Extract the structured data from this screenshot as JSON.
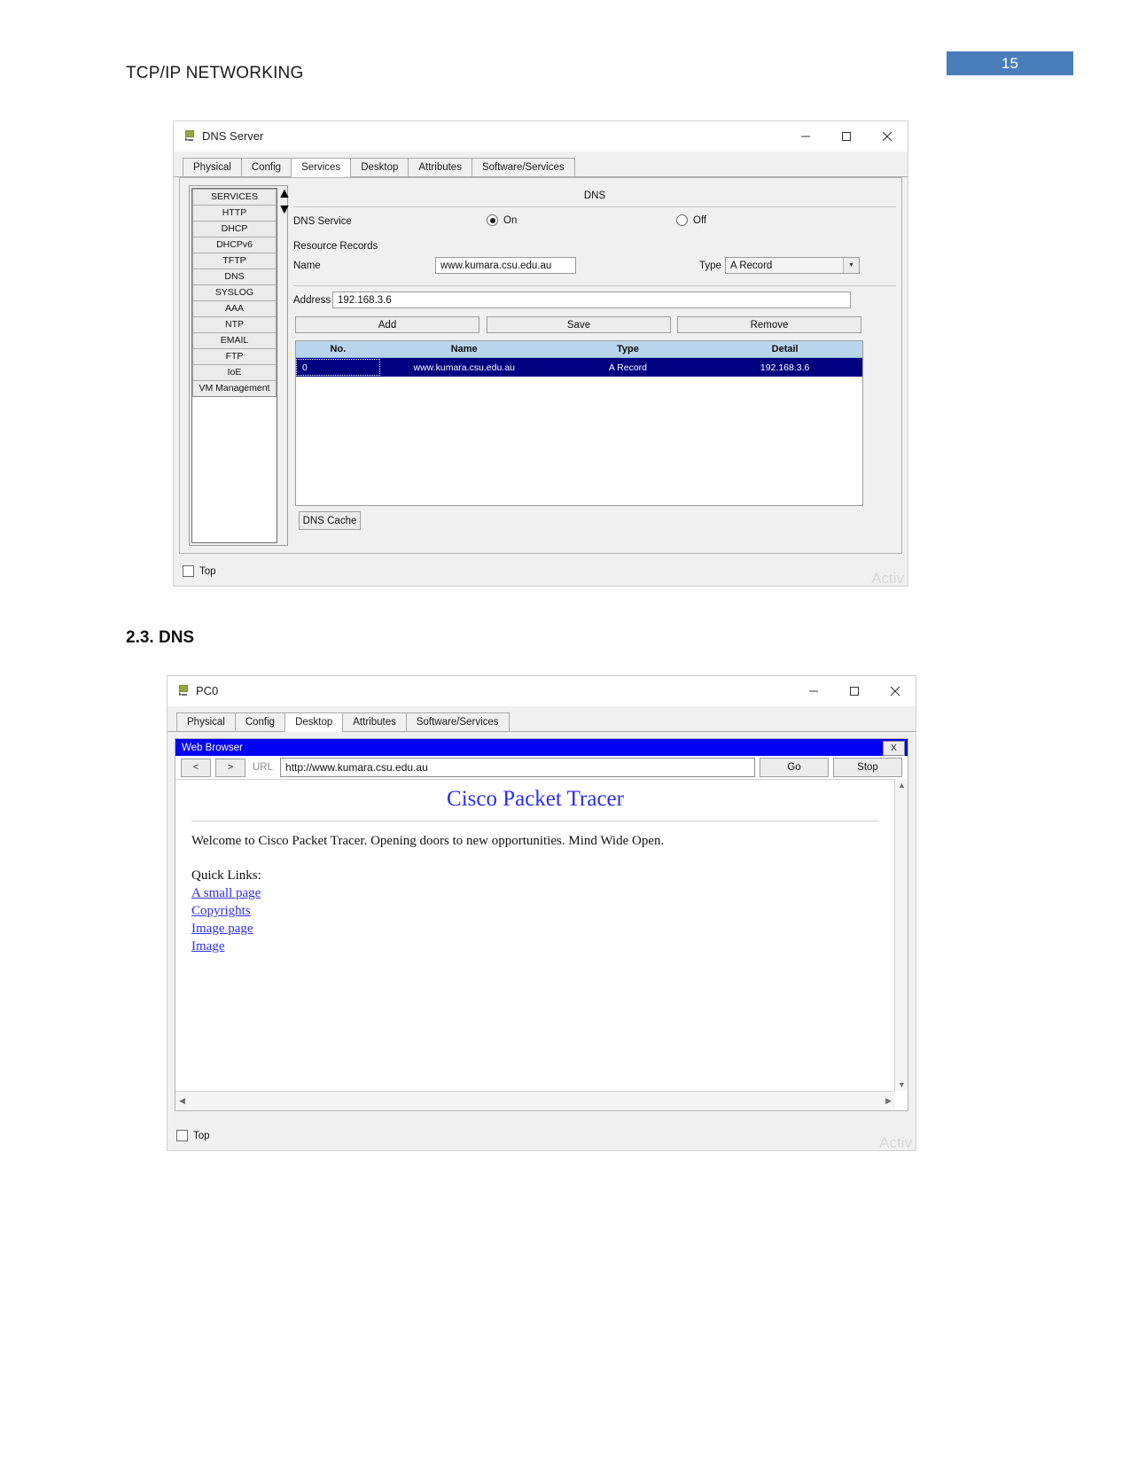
{
  "document": {
    "header_title": "TCP/IP NETWORKING",
    "page_number": "15",
    "page_badge_color": "#4A7EBB",
    "section_heading": "2.3. DNS"
  },
  "dns_window": {
    "title": "DNS Server",
    "icon": "packet-tracer-device-icon",
    "window_controls": {
      "minimize": "–",
      "maximize": "□",
      "close": "✕"
    },
    "tabs": [
      {
        "label": "Physical",
        "active": false
      },
      {
        "label": "Config",
        "active": false
      },
      {
        "label": "Services",
        "active": true
      },
      {
        "label": "Desktop",
        "active": false
      },
      {
        "label": "Attributes",
        "active": false
      },
      {
        "label": "Software/Services",
        "active": false
      }
    ],
    "services_list": [
      "SERVICES",
      "HTTP",
      "DHCP",
      "DHCPv6",
      "TFTP",
      "DNS",
      "SYSLOG",
      "AAA",
      "NTP",
      "EMAIL",
      "FTP",
      "IoE",
      "VM Management"
    ],
    "panel_heading": "DNS",
    "service_label": "DNS Service",
    "service_on_label": "On",
    "service_off_label": "Off",
    "service_state": "On",
    "resource_records_label": "Resource Records",
    "name_label": "Name",
    "name_value": "www.kumara.csu.edu.au",
    "type_label": "Type",
    "type_value": "A Record",
    "address_label": "Address",
    "address_value": "192.168.3.6",
    "buttons": {
      "add": "Add",
      "save": "Save",
      "remove": "Remove"
    },
    "table": {
      "columns": [
        "No.",
        "Name",
        "Type",
        "Detail"
      ],
      "rows": [
        {
          "no": "0",
          "name": "www.kumara.csu.edu.au",
          "type": "A Record",
          "detail": "192.168.3.6"
        }
      ]
    },
    "dns_cache_button": "DNS Cache",
    "top_checkbox_label": "Top",
    "watermark": "Activ"
  },
  "pc_window": {
    "title": "PC0",
    "icon": "packet-tracer-device-icon",
    "window_controls": {
      "minimize": "–",
      "maximize": "□",
      "close": "✕"
    },
    "tabs": [
      {
        "label": "Physical",
        "active": false
      },
      {
        "label": "Config",
        "active": false
      },
      {
        "label": "Desktop",
        "active": true
      },
      {
        "label": "Attributes",
        "active": false
      },
      {
        "label": "Software/Services",
        "active": false
      }
    ],
    "browser": {
      "title": "Web Browser",
      "close_label": "X",
      "back_label": "<",
      "forward_label": ">",
      "url_label": "URL",
      "url_value": "http://www.kumara.csu.edu.au",
      "go_label": "Go",
      "stop_label": "Stop",
      "page": {
        "heading": "Cisco Packet Tracer",
        "welcome": "Welcome to Cisco Packet Tracer. Opening doors to new opportunities. Mind Wide Open.",
        "quick_links_label": "Quick Links:",
        "links": [
          "A small page",
          "Copyrights",
          "Image page",
          "Image"
        ]
      }
    },
    "top_checkbox_label": "Top",
    "watermark": "Activ"
  }
}
